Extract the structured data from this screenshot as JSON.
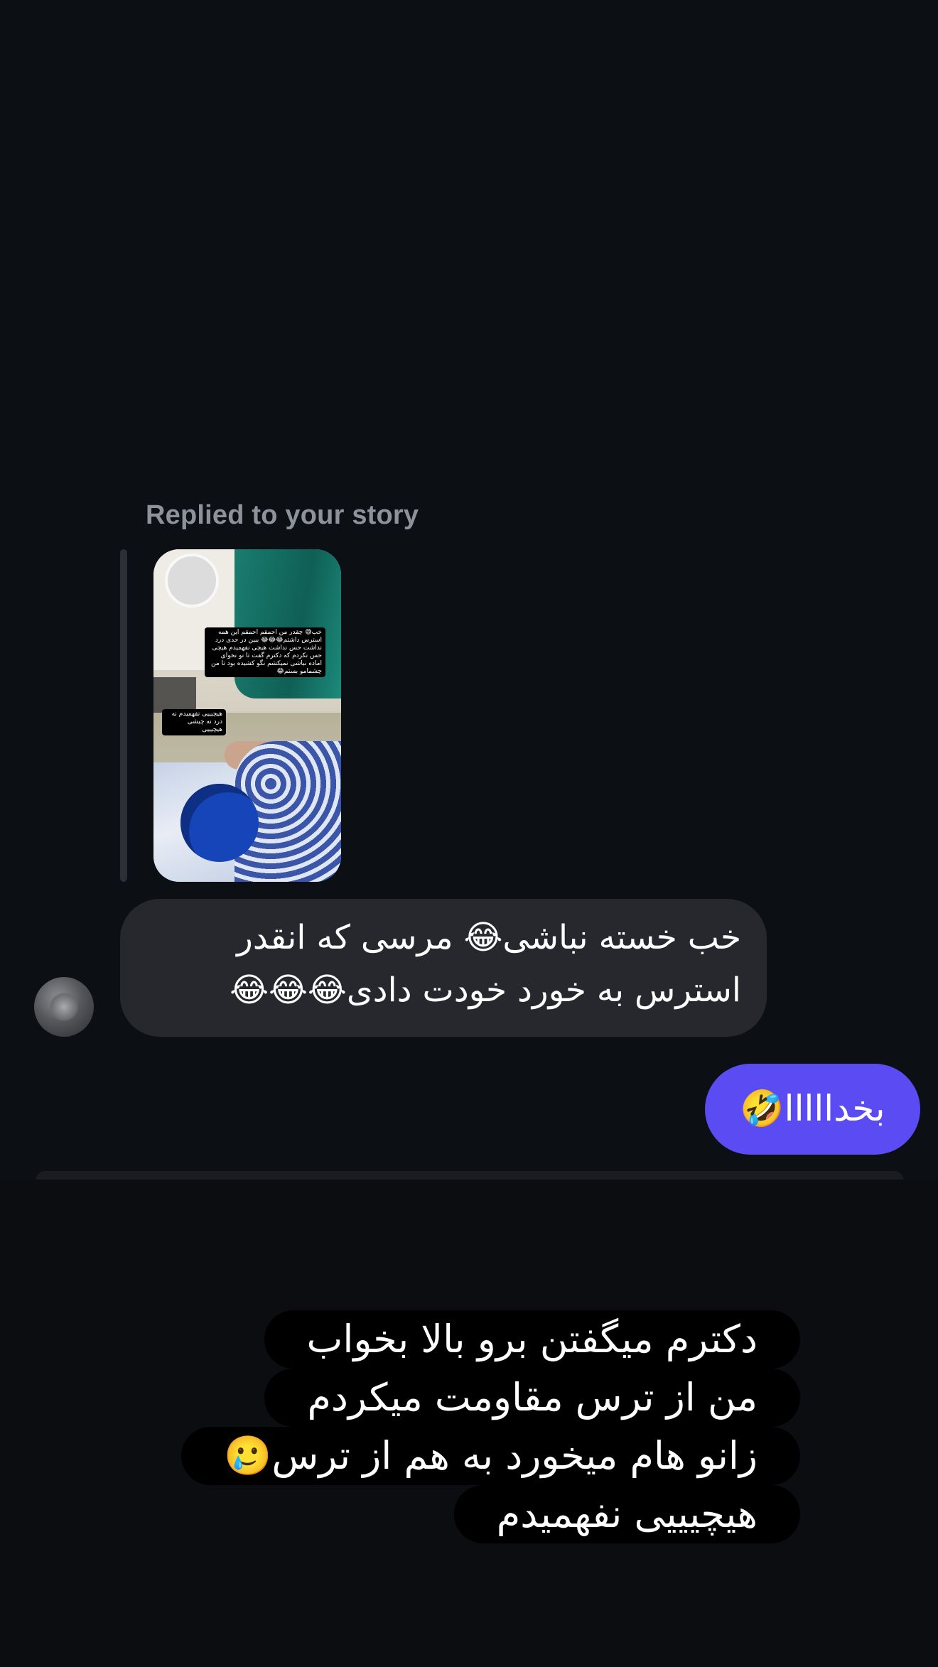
{
  "reply_header": {
    "label": "Replied to your story"
  },
  "story_preview": {
    "overlay_text_1": "خب😅 چقدر من احمقم احمقم این همه استرس داشتم😂😂😂 ببین در حدی درد نداشت حس نداشت هیچی نفهمیدم هیچی حس نکردم که دکترم گفت تا نو نخوای اماده نباشی نمیکشم نگو کشیده بود تا من چشمامو بستم😂",
    "overlay_text_2": "هیچیییی نفهمیدم نه درد نه چیشی هیچیییی"
  },
  "incoming_message": {
    "text": "خب خسته نباشی😂 مرسی که انقدر استرس به خورد خودت دادی😂😂😂"
  },
  "outgoing_message": {
    "text": "بخدااااا🤣"
  },
  "story_caption": {
    "lines": [
      "دکترم میگفتن برو بالا بخواب",
      "من از ترس مقاومت میکردم",
      "زانو هام میخورد به هم از ترس🥲",
      "هیچیییی نفهمیدم"
    ]
  },
  "colors": {
    "background": "#0c0f14",
    "incoming_bubble": "#26282e",
    "outgoing_bubble": "#5a4bf3",
    "muted_text": "#8d929b"
  }
}
